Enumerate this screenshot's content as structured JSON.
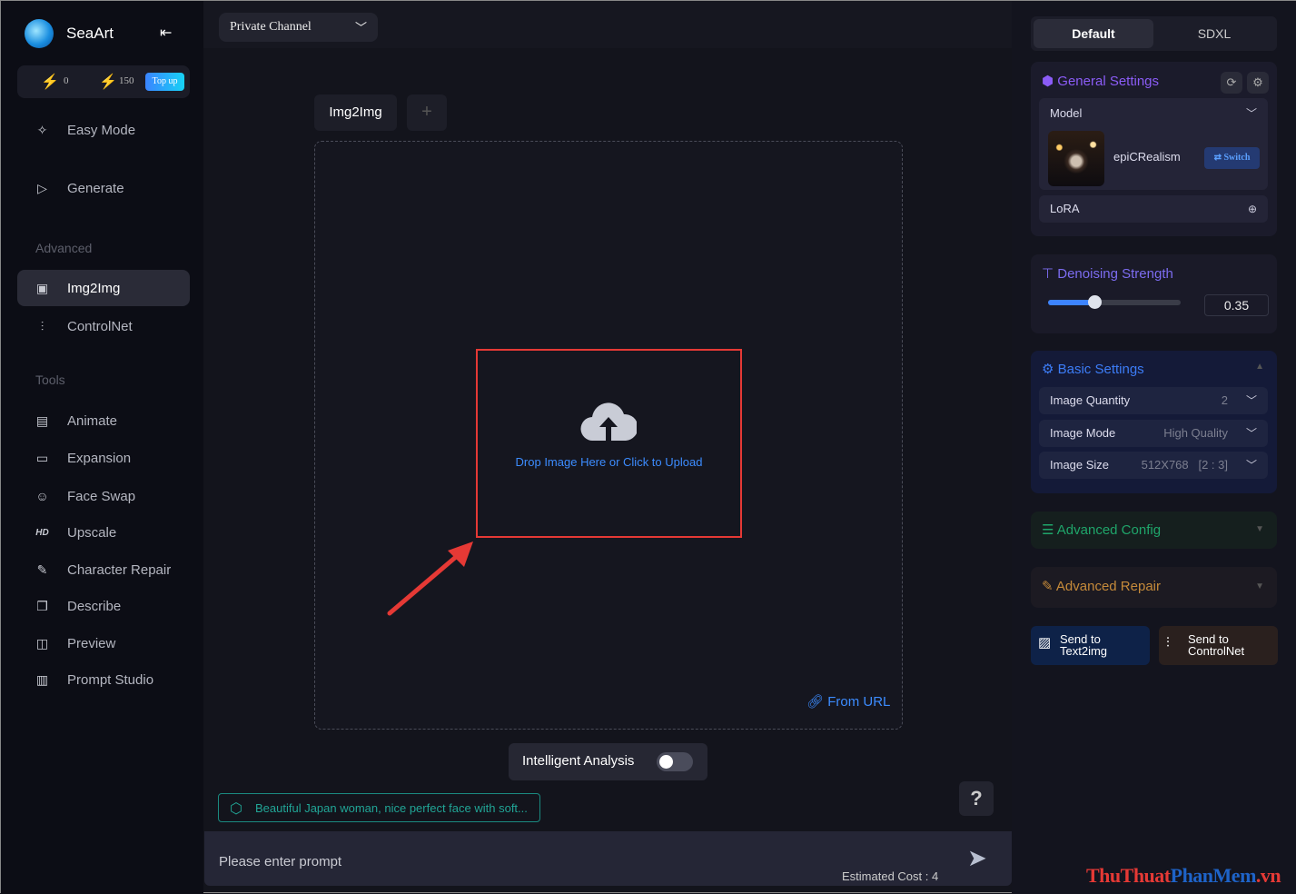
{
  "app": {
    "name": "SeaArt",
    "collapse_icon": "collapse-left-icon"
  },
  "credits": {
    "stamina": "0",
    "energy": "150",
    "topup": "Top up"
  },
  "nav": {
    "main": [
      {
        "label": "Easy Mode",
        "icon": "sparkle-icon"
      },
      {
        "label": "Generate",
        "icon": "play-icon"
      }
    ],
    "advanced_title": "Advanced",
    "advanced": [
      {
        "label": "Img2Img",
        "icon": "image-icon",
        "active": true
      },
      {
        "label": "ControlNet",
        "icon": "sliders-icon"
      }
    ],
    "tools_title": "Tools",
    "tools": [
      {
        "label": "Animate"
      },
      {
        "label": "Expansion"
      },
      {
        "label": "Face Swap"
      },
      {
        "label": "Upscale"
      },
      {
        "label": "Character Repair"
      },
      {
        "label": "Describe"
      },
      {
        "label": "Preview"
      },
      {
        "label": "Prompt Studio"
      }
    ]
  },
  "channel": {
    "value": "Private Channel"
  },
  "tabs": {
    "active": "Img2Img",
    "add": "+"
  },
  "upload": {
    "text": "Drop Image Here or Click to Upload",
    "from_url": "From URL"
  },
  "intelligent_analysis": {
    "label": "Intelligent Analysis",
    "on": false
  },
  "suggestion": "Beautiful Japan woman, nice perfect face with soft...",
  "help": "?",
  "prompt": {
    "placeholder": "Please enter prompt",
    "cost": "Estimated Cost : 4"
  },
  "right": {
    "mode_tabs": [
      "Default",
      "SDXL"
    ],
    "general": {
      "title": "General Settings",
      "model_label": "Model",
      "model_name": "epiCRealism",
      "switch": "Switch",
      "lora": "LoRA"
    },
    "denoise": {
      "title": "Denoising Strength",
      "value": "0.35",
      "fraction": 0.35
    },
    "basic": {
      "title": "Basic Settings",
      "rows": [
        {
          "label": "Image Quantity",
          "value": "2"
        },
        {
          "label": "Image Mode",
          "value": "High Quality"
        },
        {
          "label": "Image Size",
          "value": "512X768   [2 : 3]"
        }
      ]
    },
    "advanced_config": "Advanced Config",
    "advanced_repair": "Advanced Repair",
    "send_text2img": [
      "Send to",
      "Text2img"
    ],
    "send_controlnet": [
      "Send to",
      "ControlNet"
    ]
  },
  "colors": {
    "accent_blue": "#3c8cff",
    "highlight": "#e53935",
    "general": "#8b5cf6",
    "advanced_config": "#1fa56a",
    "advanced_repair": "#c58a3a"
  },
  "watermark": "ThuThuatPhanMem.vn"
}
